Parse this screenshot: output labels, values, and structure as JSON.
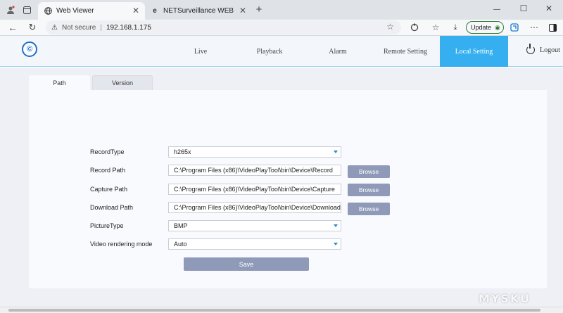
{
  "browser": {
    "tabs": [
      {
        "title": "Web Viewer",
        "icon": "globe-icon",
        "active": true
      },
      {
        "title": "NETSurveillance WEB",
        "icon": "edge-icon",
        "active": false
      }
    ],
    "new_tab": "+",
    "address": {
      "security": "Not secure",
      "url": "192.168.1.175"
    },
    "update_label": "Update",
    "window_controls": {
      "minimize": "—",
      "maximize": "☐",
      "close": "✕"
    }
  },
  "app": {
    "nav": [
      {
        "label": "Live"
      },
      {
        "label": "Playback"
      },
      {
        "label": "Alarm"
      },
      {
        "label": "Remote Setting"
      },
      {
        "label": "Local Setting",
        "active": true
      }
    ],
    "logout_label": "Logout",
    "tabs": [
      {
        "label": "Path",
        "active": true
      },
      {
        "label": "Version",
        "active": false
      }
    ],
    "form": {
      "record_type": {
        "label": "RecordType",
        "value": "h265x"
      },
      "record_path": {
        "label": "Record Path",
        "value": "C:\\Program Files (x86)\\VideoPlayTool\\bin\\Device\\Record",
        "button": "Browse"
      },
      "capture_path": {
        "label": "Capture Path",
        "value": "C:\\Program Files (x86)\\VideoPlayTool\\bin\\Device\\Capture",
        "button": "Browse"
      },
      "download_path": {
        "label": "Download Path",
        "value": "C:\\Program Files (x86)\\VideoPlayTool\\bin\\Device\\Download",
        "button": "Browse"
      },
      "picture_type": {
        "label": "PictureType",
        "value": "BMP"
      },
      "render_mode": {
        "label": "Video rendering mode",
        "value": "Auto"
      },
      "save_label": "Save"
    },
    "colors": {
      "accent": "#35aff0",
      "button": "#8f9ab8"
    }
  },
  "watermark": "MYSKU"
}
